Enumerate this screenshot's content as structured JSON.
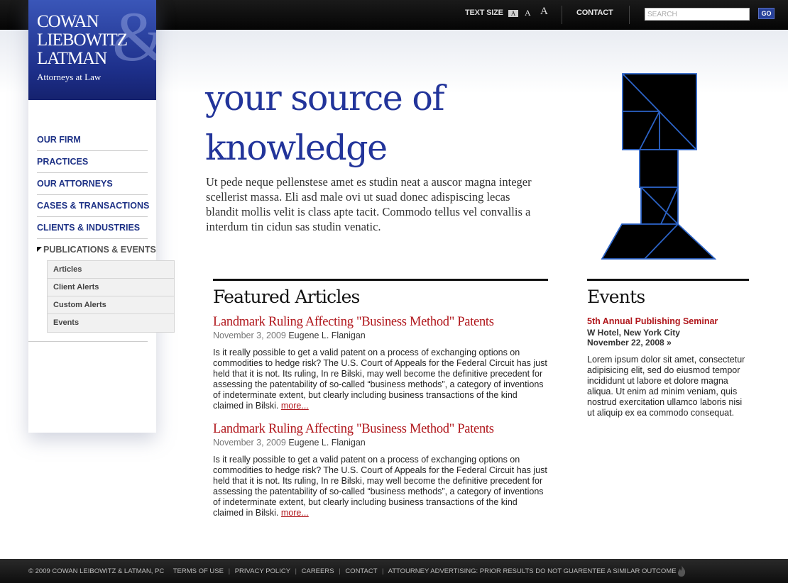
{
  "header": {
    "text_size_label": "TEXT SIZE",
    "text_size_small": "A",
    "text_size_medium": "A",
    "text_size_large": "A",
    "contact": "CONTACT",
    "search_placeholder": "SEARCH",
    "go": "GO"
  },
  "logo": {
    "line1": "COWAN",
    "line2": "LIEBOWITZ",
    "line3": "LATMAN",
    "ampersand": "&",
    "subtitle": "Attorneys at Law"
  },
  "nav": {
    "items": [
      {
        "label": "OUR FIRM"
      },
      {
        "label": "PRACTICES"
      },
      {
        "label": "OUR ATTORNEYS"
      },
      {
        "label": "CASES & TRANSACTIONS"
      },
      {
        "label": "CLIENTS & INDUSTRIES"
      }
    ],
    "active": "PUBLICATIONS & EVENTS",
    "subitems": [
      {
        "label": "Articles"
      },
      {
        "label": "Client Alerts"
      },
      {
        "label": "Custom Alerts"
      },
      {
        "label": "Events"
      }
    ]
  },
  "hero": {
    "title_line1": "your source of",
    "title_line2": "knowledge",
    "text": "Ut pede neque pellenstese amet es studin neat a auscor magna integer scellerist massa. Eli asd male ovi ut suad donec adispiscing lecas blandit mollis velit is class apte tacit. Commodo tellus vel convallis a interdum tin cidun sas studin venatic."
  },
  "featured": {
    "heading": "Featured Articles",
    "articles": [
      {
        "title": "Landmark Ruling Affecting \"Business Method\" Patents",
        "date": "November 3, 2009",
        "author": "Eugene L. Flanigan",
        "body": "Is it really possible to get a valid patent on a process of exchanging options on commodities to hedge risk? The U.S. Court of Appeals for the Federal Circuit has just held that it is not. Its ruling, In re Bilski, may well become the definitive precedent for assessing the patentability of so-called “business methods”, a category of inventions of indeterminate extent, but clearly including business transactions of the kind claimed in Bilski.",
        "more": "more..."
      },
      {
        "title": "Landmark Ruling Affecting \"Business Method\" Patents",
        "date": "November 3, 2009",
        "author": "Eugene L. Flanigan",
        "body": "Is it really possible to get a valid patent on a process of exchanging options on commodities to hedge risk? The U.S. Court of Appeals for the Federal Circuit has just held that it is not. Its ruling, In re Bilski, may well become the definitive precedent for assessing the patentability of so-called “business methods”, a category of inventions of indeterminate extent, but clearly including business transactions of the kind claimed in Bilski.",
        "more": "more..."
      }
    ]
  },
  "events": {
    "heading": "Events",
    "title": "5th Annual Publishing Seminar",
    "location": "W Hotel, New York City",
    "date": "November 22, 2008 »",
    "body": "Lorem ipsum dolor sit amet, consectetur adipisicing elit, sed do eiusmod tempor incididunt ut labore et dolore magna aliqua. Ut enim ad minim veniam, quis nostrud exercitation ullamco laboris nisi ut aliquip ex ea commodo consequat."
  },
  "footer": {
    "copyright": "© 2009 COWAN LEIBOWITZ & LATMAN, PC",
    "links": [
      {
        "label": "TERMS OF USE"
      },
      {
        "label": "PRIVACY POLICY"
      },
      {
        "label": "CAREERS"
      },
      {
        "label": "CONTACT"
      },
      {
        "label": "ATTOURNEY ADVERTISING: PRIOR RESULTS DO NOT GUARENTEE A SIMILAR OUTCOME"
      }
    ],
    "separator": "|"
  },
  "colors": {
    "brand_blue": "#22349a",
    "link_red": "#b0161b",
    "nav_blue": "#1e3286"
  }
}
